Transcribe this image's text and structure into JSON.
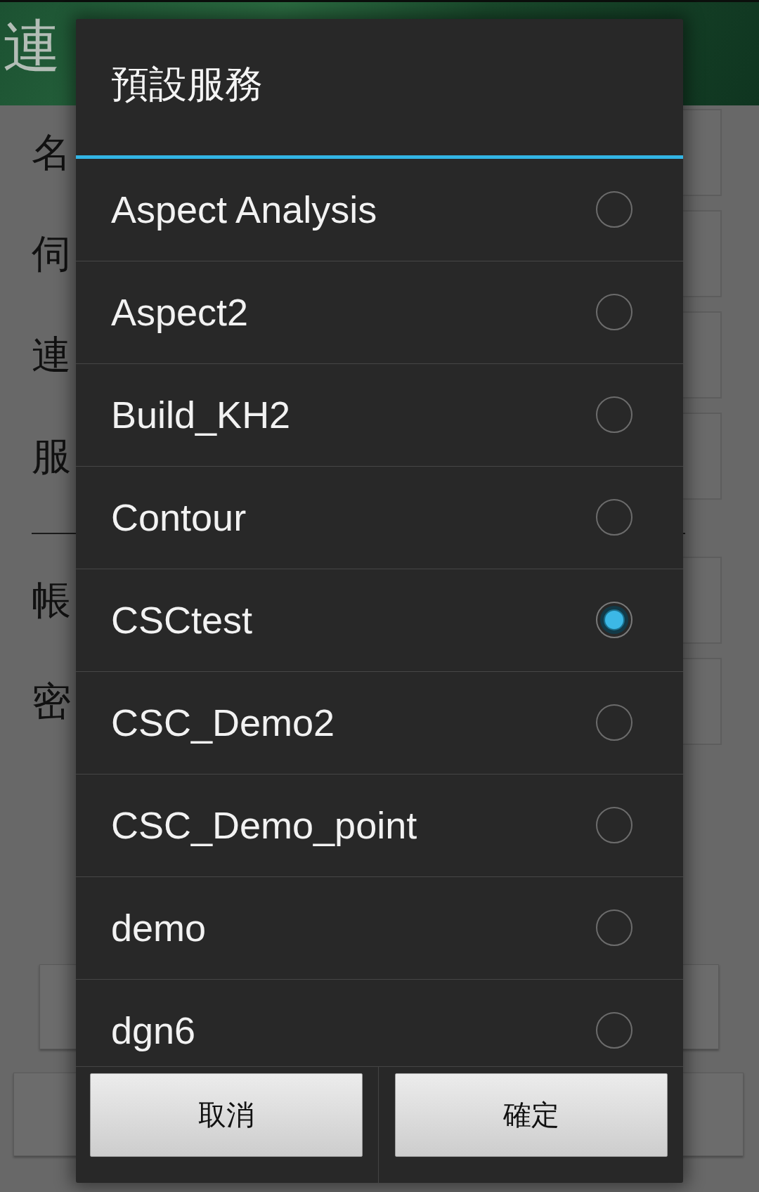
{
  "background_screen": {
    "header": {
      "title": "連"
    },
    "form_sections": [
      {
        "rows": [
          {
            "label": "名"
          },
          {
            "label": "伺"
          },
          {
            "label": "連"
          },
          {
            "label": "服"
          }
        ]
      },
      {
        "rows": [
          {
            "label": "帳"
          },
          {
            "label": "密"
          }
        ]
      }
    ]
  },
  "dialog": {
    "title": "預設服務",
    "options": [
      {
        "label": "Aspect Analysis",
        "selected": false
      },
      {
        "label": "Aspect2",
        "selected": false
      },
      {
        "label": "Build_KH2",
        "selected": false
      },
      {
        "label": "Contour",
        "selected": false
      },
      {
        "label": "CSCtest",
        "selected": true
      },
      {
        "label": "CSC_Demo2",
        "selected": false
      },
      {
        "label": "CSC_Demo_point",
        "selected": false
      },
      {
        "label": "demo",
        "selected": false
      },
      {
        "label": "dgn6",
        "selected": false
      }
    ],
    "buttons": [
      {
        "label": "取消"
      },
      {
        "label": "確定"
      }
    ]
  }
}
